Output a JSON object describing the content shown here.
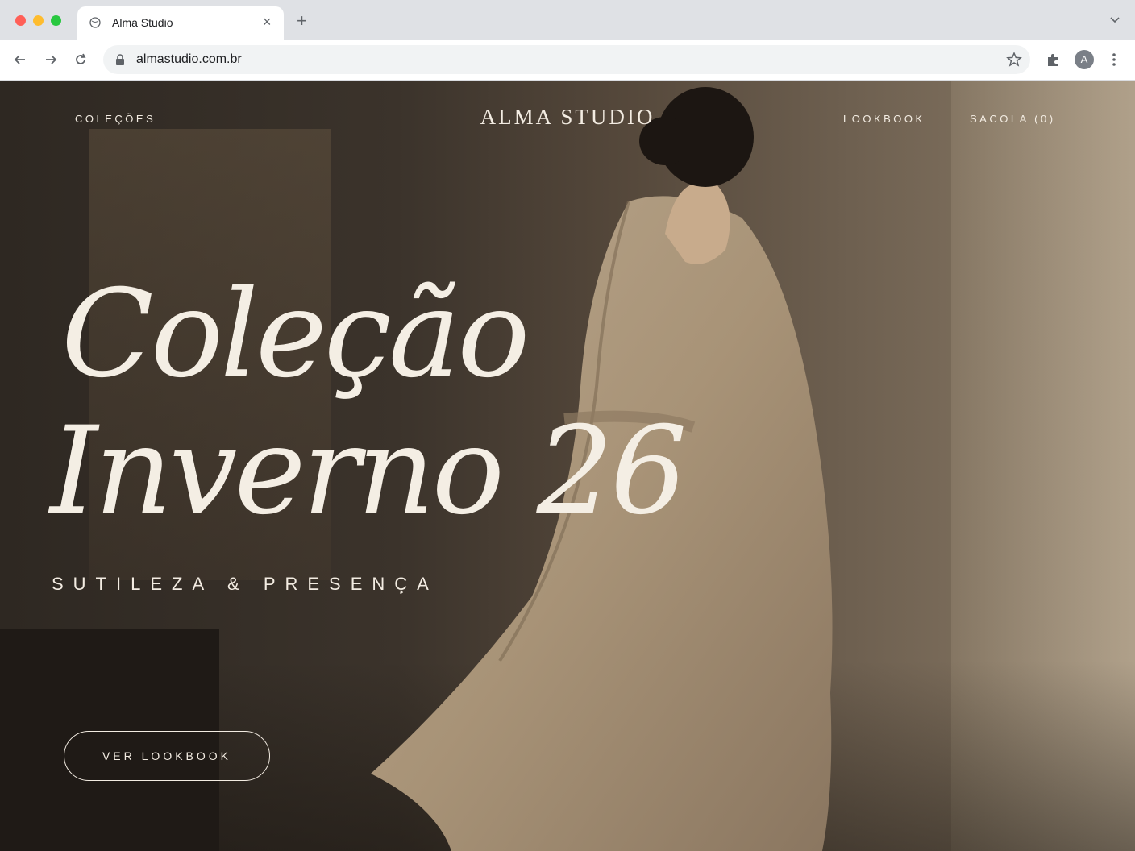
{
  "browser": {
    "tab_title": "Alma Studio",
    "tab_close": "×",
    "new_tab": "+",
    "url": "almastudio.com.br",
    "avatar_initial": "A"
  },
  "site": {
    "nav_left": "COLEÇÕES",
    "brand": "ALMA STUDIO",
    "nav_lookbook": "LOOKBOOK",
    "nav_bag": "SACOLA (0)"
  },
  "hero": {
    "headline_line1": "Coleção",
    "headline_line2": "Inverno 26",
    "tagline": "SUTILEZA & PRESENÇA",
    "cta_label": "VER LOOKBOOK"
  },
  "colors": {
    "text_cream": "#f3ece2",
    "hero_dark": "#2e2822"
  }
}
